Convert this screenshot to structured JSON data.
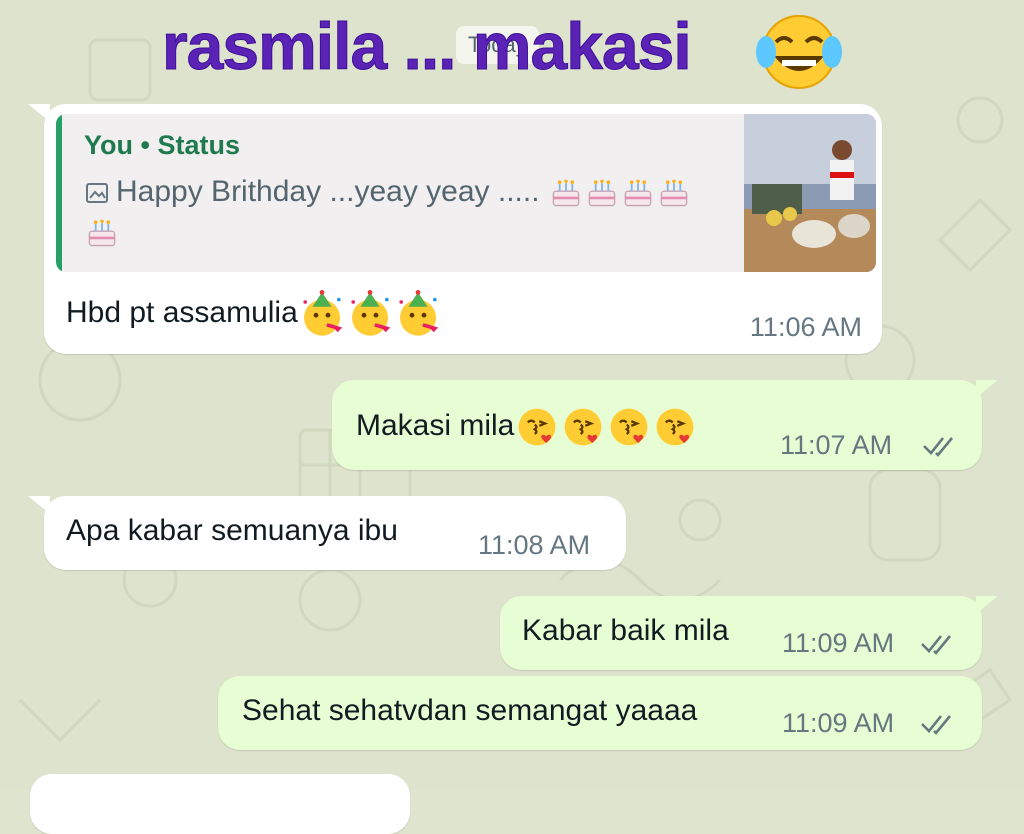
{
  "overlay": {
    "caption": "rasmila ... makasi",
    "caption_emoji_icon": "face-with-tears-of-joy-icon"
  },
  "date_chip": "Today",
  "messages": [
    {
      "direction": "in",
      "quote": {
        "author": "You • Status",
        "type_icon": "image-icon",
        "text": "Happy Brithday ...yeay yeay .....",
        "emoji_icon": "birthday-cake-icon",
        "emoji_count": 5,
        "thumbnail": "status-photo"
      },
      "text": "Hbd pt assamulia",
      "emoji_icon": "partying-face-icon",
      "emoji_count": 3,
      "time": "11:06 AM"
    },
    {
      "direction": "out",
      "text": "Makasi mila",
      "emoji_icon": "face-blowing-kiss-icon",
      "emoji_count": 4,
      "time": "11:07 AM",
      "status_icon": "double-check-icon"
    },
    {
      "direction": "in",
      "text": "Apa kabar semuanya ibu",
      "time": "11:08 AM"
    },
    {
      "direction": "out",
      "text": "Kabar baik mila",
      "time": "11:09 AM",
      "status_icon": "double-check-icon"
    },
    {
      "direction": "out",
      "text": "Sehat sehatvdan semangat yaaaa",
      "time": "11:09 AM",
      "status_icon": "double-check-icon"
    }
  ],
  "colors": {
    "wallpaper": "#dde3cc",
    "incoming_bubble": "#ffffff",
    "outgoing_bubble": "#e7fdd3",
    "caption": "#5a22b5",
    "quote_author": "#1f7a4f"
  }
}
